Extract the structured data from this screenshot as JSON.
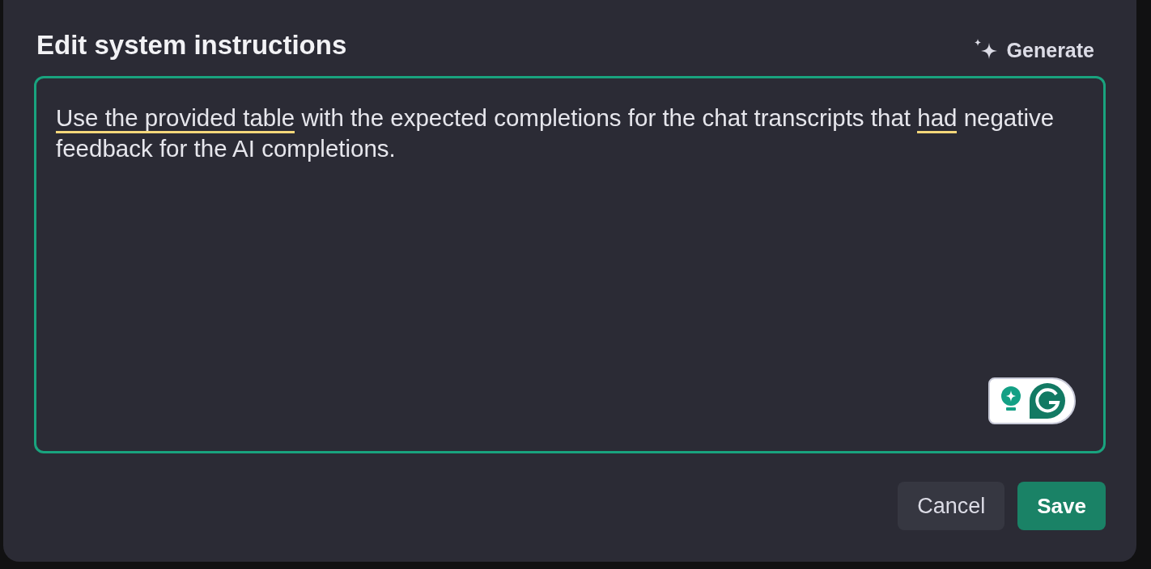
{
  "dialog": {
    "title": "Edit system instructions",
    "generate_button": "Generate",
    "instructions": {
      "segments": [
        {
          "text": "Use the provided table",
          "flagged": true
        },
        {
          "text": " with the expected completions for the chat transcripts that ",
          "flagged": false
        },
        {
          "text": "had",
          "flagged": true
        },
        {
          "text": " negative feedback for the AI completions.",
          "flagged": false
        }
      ]
    },
    "buttons": [
      {
        "label": "Cancel",
        "kind": "secondary"
      },
      {
        "label": "Save",
        "kind": "primary"
      }
    ]
  }
}
